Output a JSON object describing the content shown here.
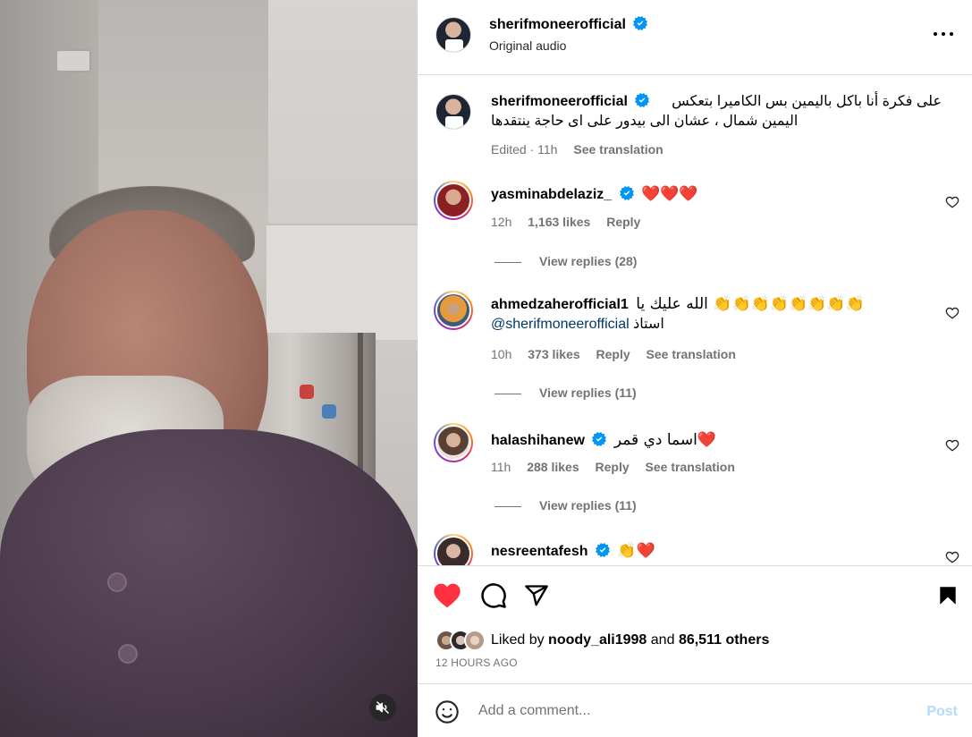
{
  "post": {
    "username": "sherifmoneerofficial",
    "audio": "Original audio",
    "more_icon": "more-horizontal-icon",
    "verified_color": "#0095f6"
  },
  "caption": {
    "username": "sherifmoneerofficial",
    "text_line1": "على فكرة أنا باكل باليمين بس الكاميرا بتعكس",
    "text_line2": "اليمين شمال ، عشان الى بيدور على اى حاجة ينتقدها",
    "edited": "Edited · 11h",
    "see_translation": "See translation"
  },
  "comments": [
    {
      "username": "yasminabdelaziz_",
      "text": "❤️❤️❤️",
      "time": "12h",
      "likes": "1,163 likes",
      "reply": "Reply",
      "view_replies": "View replies (28)"
    },
    {
      "username": "ahmedzaherofficial1",
      "text_line1": "👏👏👏👏👏👏👏👏 الله عليك يا",
      "mention": "@sherifmoneerofficial",
      "text_line2": "استاذ",
      "time": "10h",
      "likes": "373 likes",
      "reply": "Reply",
      "see_translation": "See translation",
      "view_replies": "View replies (11)"
    },
    {
      "username": "halashihanew",
      "text": "اسما دي قمر❤️",
      "time": "11h",
      "likes": "288 likes",
      "reply": "Reply",
      "see_translation": "See translation",
      "view_replies": "View replies (11)"
    },
    {
      "username": "nesreentafesh",
      "text": "👏❤️"
    }
  ],
  "actions": {
    "like_icon": "heart-filled-icon",
    "comment_icon": "comment-icon",
    "share_icon": "share-icon",
    "save_icon": "bookmark-icon",
    "like_color": "#ff3040"
  },
  "likes": {
    "prefix": "Liked by",
    "user": "noody_ali1998",
    "middle": "and",
    "others": "86,511 others"
  },
  "timestamp": "12 HOURS AGO",
  "add_comment": {
    "placeholder": "Add a comment...",
    "post_label": "Post",
    "emoji_icon": "smiley-icon"
  },
  "media": {
    "mute_icon": "muted-speaker-icon"
  }
}
